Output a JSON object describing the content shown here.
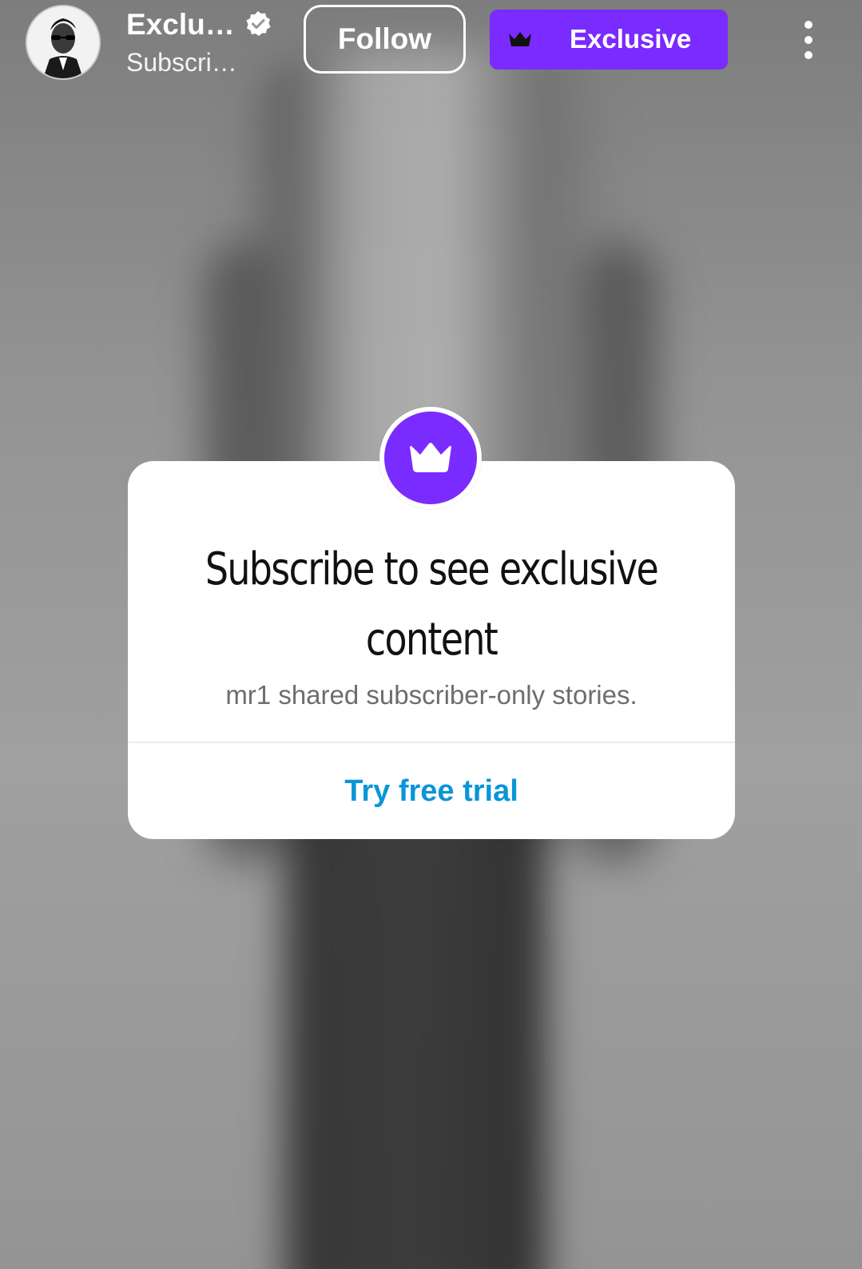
{
  "header": {
    "username": "Exclu…",
    "subtitle": "Subscri…",
    "follow_label": "Follow",
    "exclusive_label": "Exclusive"
  },
  "modal": {
    "title": "Subscribe to see exclusive content",
    "message": "mr1 shared subscriber-only stories.",
    "cta_label": "Try free trial"
  },
  "icons": {
    "verified": "verified-badge-icon",
    "crown": "crown-icon",
    "more": "more-vertical-icon"
  },
  "colors": {
    "accent": "#7a2bff",
    "link": "#0a95d6",
    "title": "#111111",
    "muted": "#6d6d6d"
  }
}
